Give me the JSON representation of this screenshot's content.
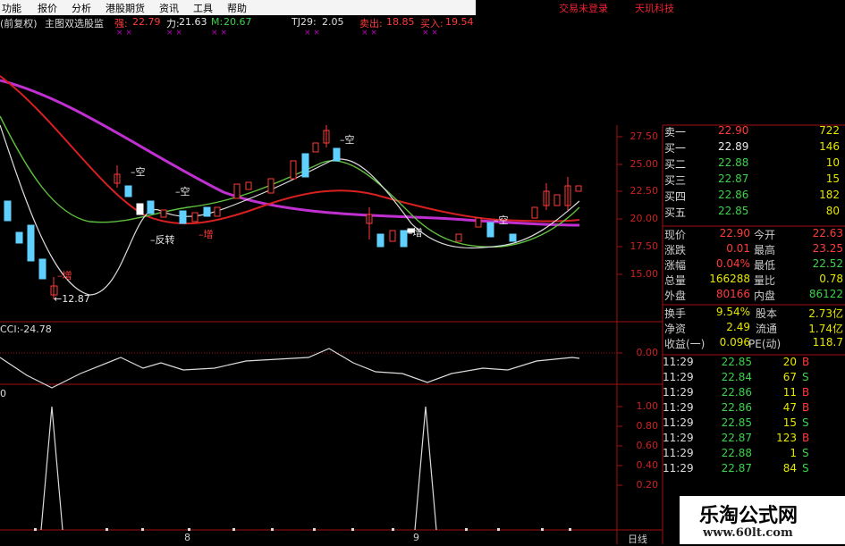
{
  "menu": {
    "items": [
      "功能",
      "报价",
      "分析",
      "港股期货",
      "资讯",
      "工具",
      "帮助"
    ]
  },
  "top_right": {
    "login_status": "交易未登录",
    "brand": "天玑科技"
  },
  "info_bar": {
    "prefix": "(前复权)",
    "indicator_name": "主图双选股监",
    "field1_label": "强:",
    "field1_value": "22.79",
    "field2_label": "力:",
    "field2_value": "21.63",
    "field3_label": "M:",
    "field3_value": "20.67",
    "field4_label": "TJ29:",
    "field4_value": "2.05",
    "sell_label": "卖出:",
    "sell_value": "18.85",
    "buy_label": "买入:",
    "buy_value": "19.54"
  },
  "main_chart": {
    "y_ticks": [
      "27.50",
      "25.00",
      "22.50",
      "20.00",
      "17.50",
      "15.00"
    ],
    "annotations": {
      "kong1": "空",
      "kong2": "空",
      "kong3": "空",
      "kong4": "空",
      "fanzhuan": "反转",
      "zeng1": "增",
      "zeng2": "增",
      "zeng3": "增",
      "low": "12.87"
    }
  },
  "cci_panel": {
    "label": "CCI:-24.78",
    "y_tick": "0.00"
  },
  "signal_panel": {
    "label": "0",
    "y_ticks": [
      "1.00",
      "0.80",
      "0.60",
      "0.40",
      "0.20"
    ]
  },
  "bottom_axis": {
    "m1": "8",
    "m2": "9",
    "period": "日线"
  },
  "order_book": [
    {
      "label": "卖一",
      "price": "22.90",
      "vol": "722"
    },
    {
      "label": "买一",
      "price": "22.89",
      "vol": "146"
    },
    {
      "label": "买二",
      "price": "22.88",
      "vol": "10"
    },
    {
      "label": "买三",
      "price": "22.87",
      "vol": "15"
    },
    {
      "label": "买四",
      "price": "22.86",
      "vol": "182"
    },
    {
      "label": "买五",
      "price": "22.85",
      "vol": "80"
    }
  ],
  "stats": [
    {
      "l1": "现价",
      "v1": "22.90",
      "l2": "今开",
      "v2": "22.63"
    },
    {
      "l1": "涨跌",
      "v1": "0.01",
      "l2": "最高",
      "v2": "23.25"
    },
    {
      "l1": "涨幅",
      "v1": "0.04%",
      "l2": "最低",
      "v2": "22.52"
    },
    {
      "l1": "总量",
      "v1": "166288",
      "l2": "量比",
      "v2": "0.78"
    },
    {
      "l1": "外盘",
      "v1": "80166",
      "l2": "内盘",
      "v2": "86122"
    }
  ],
  "fundamentals": [
    {
      "l1": "换手",
      "v1": "9.54%",
      "l2": "股本",
      "v2": "2.73亿"
    },
    {
      "l1": "净资",
      "v1": "2.49",
      "l2": "流通",
      "v2": "1.74亿"
    },
    {
      "l1": "收益(一)",
      "v1": "0.096",
      "l2": "PE(动)",
      "v2": "118.7"
    }
  ],
  "ticks": [
    {
      "time": "11:29",
      "price": "22.85",
      "vol": "20",
      "dir": "B"
    },
    {
      "time": "11:29",
      "price": "22.84",
      "vol": "67",
      "dir": "S"
    },
    {
      "time": "11:29",
      "price": "22.86",
      "vol": "11",
      "dir": "B"
    },
    {
      "time": "11:29",
      "price": "22.86",
      "vol": "47",
      "dir": "B"
    },
    {
      "time": "11:29",
      "price": "22.85",
      "vol": "15",
      "dir": "S"
    },
    {
      "time": "11:29",
      "price": "22.87",
      "vol": "123",
      "dir": "B"
    },
    {
      "time": "11:29",
      "price": "22.88",
      "vol": "1",
      "dir": "S"
    },
    {
      "time": "11:29",
      "price": "22.87",
      "vol": "84",
      "dir": "S"
    }
  ],
  "watermark": {
    "name": "乐淘公式网",
    "url": "www.60lt.com"
  },
  "colors": {
    "up": "#ff3b3b",
    "down": "#3cd24b",
    "ma_purple": "#c030d0",
    "accent_yellow": "#e6e600"
  }
}
